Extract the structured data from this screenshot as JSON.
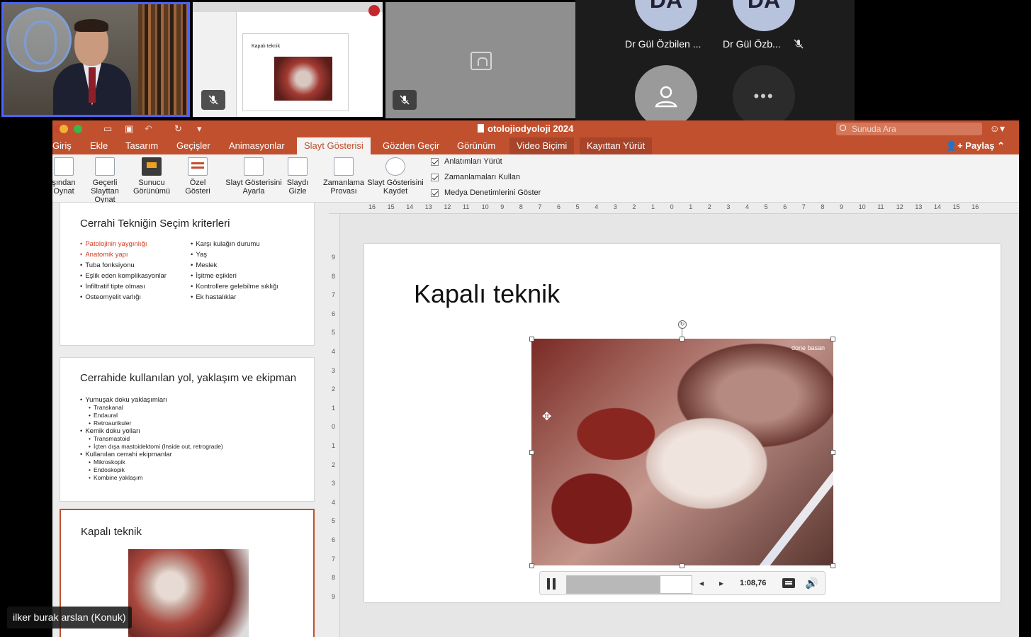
{
  "meeting": {
    "participants": [
      {
        "name": "Dr Gül Özbilen ...",
        "initials": "DA",
        "muted": false
      },
      {
        "name": "Dr Gül Özb...",
        "initials": "DA",
        "muted": true
      }
    ],
    "guest_label": "ilker burak arslan (Konuk)",
    "more_glyph": "•••"
  },
  "ppt": {
    "doc_title": "otolojiodyoloji 2024",
    "search_placeholder": "Sunuda Ara",
    "tabs": [
      {
        "label": "Giriş"
      },
      {
        "label": "Ekle"
      },
      {
        "label": "Tasarım"
      },
      {
        "label": "Geçişler"
      },
      {
        "label": "Animasyonlar"
      },
      {
        "label": "Slayt Gösterisi"
      },
      {
        "label": "Gözden Geçir"
      },
      {
        "label": "Görünüm"
      },
      {
        "label": "Video Biçimi"
      },
      {
        "label": "Kayıttan Yürüt"
      }
    ],
    "active_tab": "Slayt Gösterisi",
    "share_label": "Paylaş",
    "ribbon": {
      "from_start": [
        "şından",
        "Oynat"
      ],
      "from_current": [
        "Geçerli",
        "Slayttan Oynat"
      ],
      "presenter": [
        "Sunucu",
        "Görünümü"
      ],
      "custom": [
        "Özel",
        "Gösteri"
      ],
      "setup": [
        "Slayt Gösterisini",
        "Ayarla"
      ],
      "hide": [
        "Slaydı",
        "Gizle"
      ],
      "rehearse": [
        "Zamanlama",
        "Provası"
      ],
      "record": [
        "Slayt Gösterisini",
        "Kaydet"
      ],
      "checks": [
        "Anlatımları Yürüt",
        "Zamanlamaları Kullan",
        "Medya Denetimlerini Göster"
      ]
    },
    "thumbs": [
      {
        "title": "Cerrahi Tekniğin Seçim kriterleri",
        "left": [
          {
            "text": "Patolojinin yaygınlığı",
            "red": true
          },
          {
            "text": "Anatomik yapı",
            "red": true
          },
          {
            "text": "Tuba fonksiyonu",
            "red": false
          },
          {
            "text": "Eşlik eden komplikasyonlar",
            "red": false
          },
          {
            "text": "İnfiltratif tipte olması",
            "red": false
          },
          {
            "text": "Osteomyelit varlığı",
            "red": false
          }
        ],
        "right": [
          "Karşı kulağın durumu",
          "Yaş",
          "Meslek",
          "İşitme eşikleri",
          "Kontrollere gelebilme sıklığı",
          "Ek hastalıklar"
        ]
      },
      {
        "title": "Cerrahide kullanılan yol, yaklaşım ve ekipman",
        "items": [
          {
            "text": "Yumuşak doku yaklaşımları",
            "sub": false
          },
          {
            "text": "Transkanal",
            "sub": true
          },
          {
            "text": "Endaural",
            "sub": true
          },
          {
            "text": "Retroaurikuler",
            "sub": true
          },
          {
            "text": "Kemik doku yolları",
            "sub": false
          },
          {
            "text": "Transmastoid",
            "sub": true
          },
          {
            "text": "İçten dışa mastoidektomi (Inside out, retrograde)",
            "sub": true
          },
          {
            "text": "Kullanılan cerrahi ekipmanlar",
            "sub": false
          },
          {
            "text": "Mikroskopik",
            "sub": true
          },
          {
            "text": "Endoskopik",
            "sub": true
          },
          {
            "text": "Kombine yaklaşım",
            "sub": true
          }
        ]
      },
      {
        "title": "Kapalı teknik"
      }
    ],
    "slide": {
      "title": "Kapalı teknik",
      "video_caption": "done basan",
      "time": "1:08,76",
      "progress": 0.75
    },
    "ruler_top": [
      "16",
      "15",
      "14",
      "13",
      "12",
      "11",
      "10",
      "9",
      "8",
      "7",
      "6",
      "5",
      "4",
      "3",
      "2",
      "1",
      "0",
      "1",
      "2",
      "3",
      "4",
      "5",
      "6",
      "7",
      "8",
      "9",
      "10",
      "11",
      "12",
      "13",
      "14",
      "15",
      "16"
    ],
    "ruler_left": [
      "9",
      "8",
      "7",
      "6",
      "5",
      "4",
      "3",
      "2",
      "1",
      "0",
      "1",
      "2",
      "3",
      "4",
      "5",
      "6",
      "7",
      "8",
      "9"
    ]
  }
}
